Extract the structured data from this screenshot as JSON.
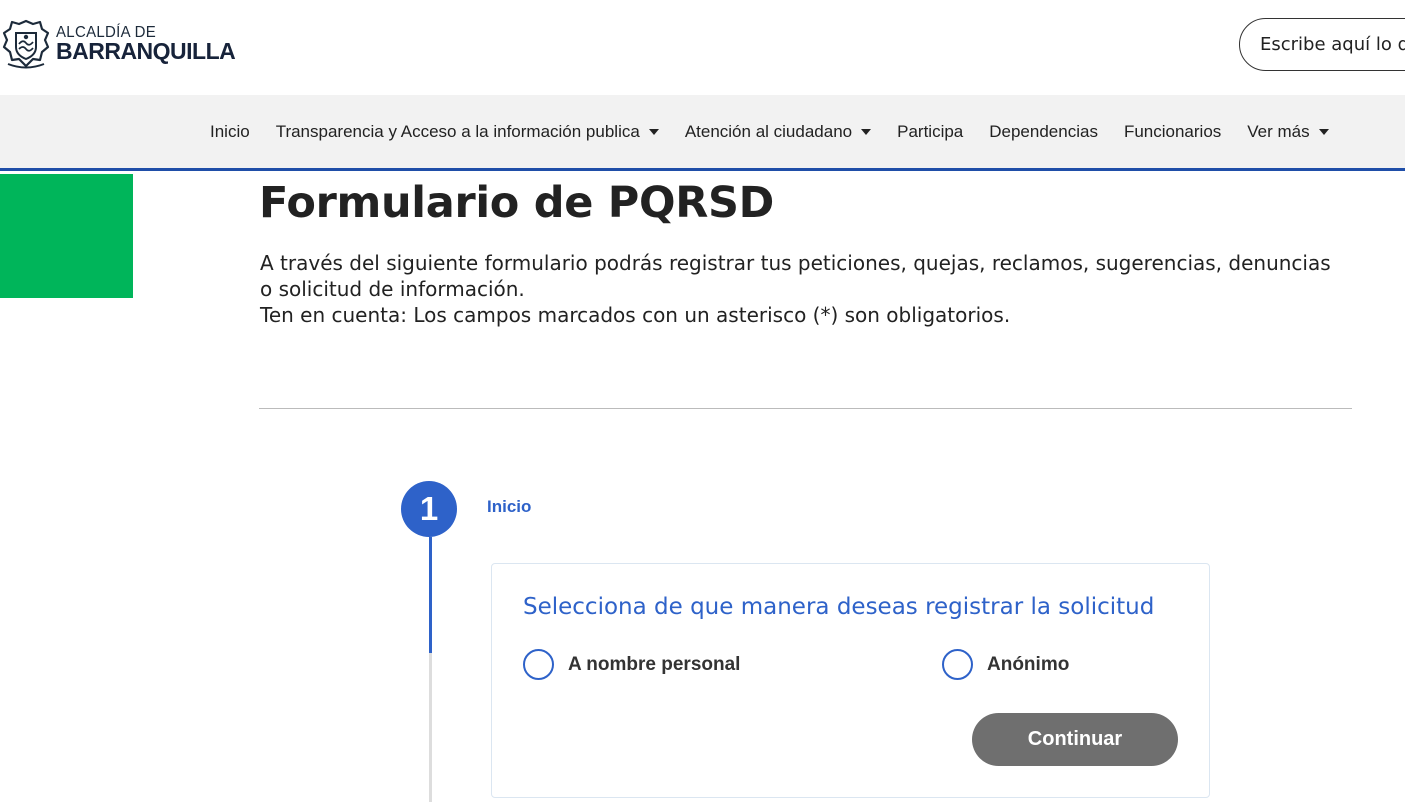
{
  "header": {
    "logo_line1": "ALCALDÍA DE",
    "logo_line2": "BARRANQUILLA",
    "search_placeholder": "Escribe aquí lo que buscas"
  },
  "nav": {
    "items": [
      {
        "label": "Inicio",
        "dropdown": false
      },
      {
        "label": "Transparencia y Acceso a la información publica",
        "dropdown": true
      },
      {
        "label": "Atención al ciudadano",
        "dropdown": true
      },
      {
        "label": "Participa",
        "dropdown": false
      },
      {
        "label": "Dependencias",
        "dropdown": false
      },
      {
        "label": "Funcionarios",
        "dropdown": false
      },
      {
        "label": "Ver más",
        "dropdown": true
      }
    ]
  },
  "page": {
    "title": "Formulario de PQRSD",
    "intro_line1": "A través del siguiente formulario podrás registrar tus peticiones, quejas, reclamos, sugerencias, denuncias o solicitud de información.",
    "intro_line2": "Ten en cuenta: Los campos marcados con un asterisco (*) son obligatorios."
  },
  "stepper": {
    "step_number": "1",
    "step_label": "Inicio"
  },
  "card": {
    "title": "Selecciona de que manera deseas registrar la solicitud",
    "options": [
      {
        "label": "A nombre personal",
        "selected": false
      },
      {
        "label": "Anónimo",
        "selected": false
      }
    ],
    "continue_label": "Continuar"
  },
  "colors": {
    "accent_blue": "#2e62c9",
    "nav_border": "#1f4ea8",
    "green_block": "#00b55a",
    "button_gray": "#6f6f6f"
  }
}
